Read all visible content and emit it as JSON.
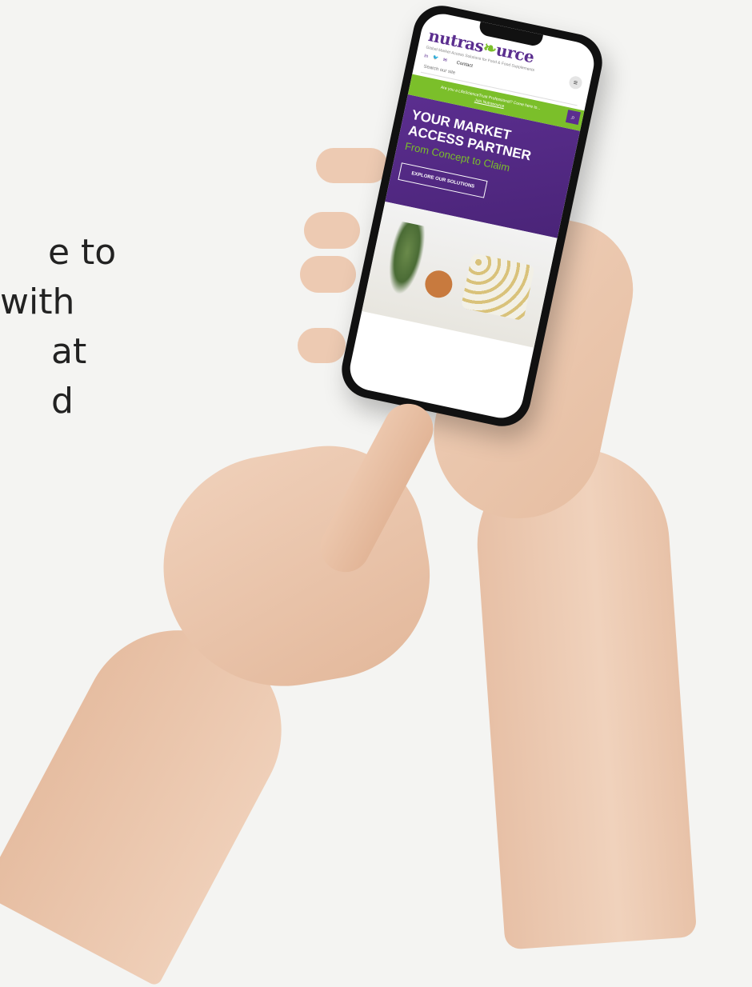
{
  "background_text": {
    "line1": "e to",
    "line2": "with",
    "line3": "at",
    "line4": "d"
  },
  "site": {
    "logo_text_a": "nutras",
    "logo_text_b": "urce",
    "tagline": "Global Market Access Solutions for Food & Food Supplements",
    "social": {
      "linkedin": "in",
      "twitter": "🐦",
      "email": "✉",
      "contact_label": "Contact"
    },
    "menu_icon": "≡",
    "search_placeholder": "Search our site",
    "search_icon": "⌕",
    "banner_text": "Are you a LifeScienceTrust Professional? Come here to...",
    "banner_link": "Join Nutrasource"
  },
  "hero": {
    "title_line1": "YOUR MARKET",
    "title_line2": "ACCESS PARTNER",
    "subtitle": "From Concept to Claim",
    "cta_label": "EXPLORE OUR SOLUTIONS"
  },
  "colors": {
    "brand_purple": "#5b2e8f",
    "brand_green": "#7bbf2a"
  }
}
